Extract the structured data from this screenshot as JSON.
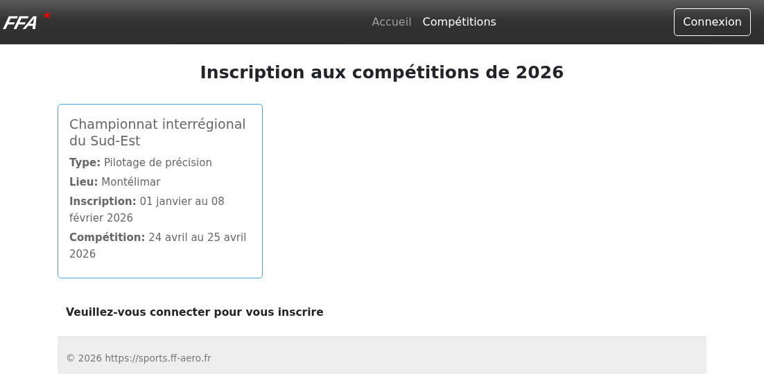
{
  "navbar": {
    "logo": "FFA",
    "links": [
      {
        "label": "Accueil",
        "selected": false
      },
      {
        "label": "Compétitions",
        "selected": true
      }
    ],
    "login_button": "Connexion"
  },
  "heading": "Inscription aux compétitions de 2026",
  "competitions": [
    {
      "title": "Championnat interrégional du Sud-Est",
      "details": [
        "**Type:** Pilotage de précision",
        "**Lieu:** Montélimar",
        "**Inscription:** 01 janvier au 08 février 2026",
        "**Compétition:** 24 avril au 25 avril 2026"
      ]
    }
  ],
  "login_notice": "Veuillez-vous connecter pour vous inscrire",
  "footer": "© 2026 https://sports.ff-aero.fr"
}
